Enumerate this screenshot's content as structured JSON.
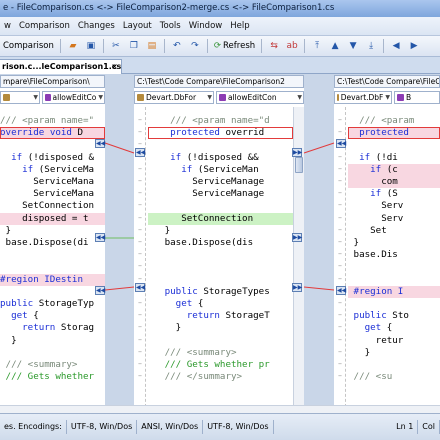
{
  "window": {
    "title": "e - FileComparison.cs <-> FileComparison2-merge.cs <-> FileComparison1.cs"
  },
  "menu": [
    {
      "label": "w"
    },
    {
      "label": "Comparison"
    },
    {
      "label": "Changes"
    },
    {
      "label": "Layout"
    },
    {
      "label": "Tools"
    },
    {
      "label": "Window"
    },
    {
      "label": "Help"
    }
  ],
  "toolbar": {
    "compare_label": "Comparison",
    "refresh_label": "Refresh"
  },
  "tab": {
    "label": "rison.c...leComparison1.cs",
    "close": "×"
  },
  "panes": {
    "left": {
      "path": "mpare\\FileComparison\\",
      "combo_member": "allowEditCo",
      "combo_type": ""
    },
    "middle": {
      "path": "C:\\Test\\Code Compare\\FileComparison2",
      "combo_type": "Devart.DbFor",
      "combo_member": "allowEditCon"
    },
    "right": {
      "path": "C:\\Test\\Code Compare\\FileComparison\\",
      "combo_type": "Devart.DbF",
      "combo_member": "B"
    }
  },
  "code": {
    "left": [
      "/// <param name=\"",
      "override void D",
      "",
      "if (!disposed &",
      "  if (ServiceMa",
      "    ServiceMana",
      "    ServiceMana",
      "  SetConnection",
      "  disposed = t",
      "}",
      "base.Dispose(di",
      "",
      "",
      "#region IDestin",
      "",
      "public StorageTyp",
      "  get {",
      "    return Storag",
      "  }",
      "",
      "/// <summary>",
      "/// Gets whether"
    ],
    "middle": [
      "/// <param name=\"d",
      "protected overrid",
      "",
      "if (!disposed &&",
      "  if (ServiceMan",
      "    ServiceManage",
      "    ServiceManage",
      "",
      "  SetConnection",
      "}",
      "base.Dispose(dis",
      "",
      "",
      "",
      "public StorageTypes",
      "  get {",
      "    return StorageT",
      "  }",
      "",
      "/// <summary>",
      "/// Gets whether pr",
      "/// </summary>"
    ],
    "right": [
      "/// <param",
      "protected",
      "",
      "if (!di",
      "  if (c",
      "    com",
      "  if (S",
      "    Serv",
      "    Serv",
      "  Set",
      "}",
      "base.Dis",
      "",
      "",
      "#region I",
      "",
      "public Sto",
      "  get {",
      "    retur",
      "  }",
      "",
      "/// <su"
    ]
  },
  "status": {
    "encodings_label": "es. Encodings:",
    "enc1": "UTF-8, Win/Dos",
    "enc2": "ANSI, Win/Dos",
    "enc3": "UTF-8, Win/Dos",
    "ln": "Ln 1",
    "col": "Col"
  }
}
